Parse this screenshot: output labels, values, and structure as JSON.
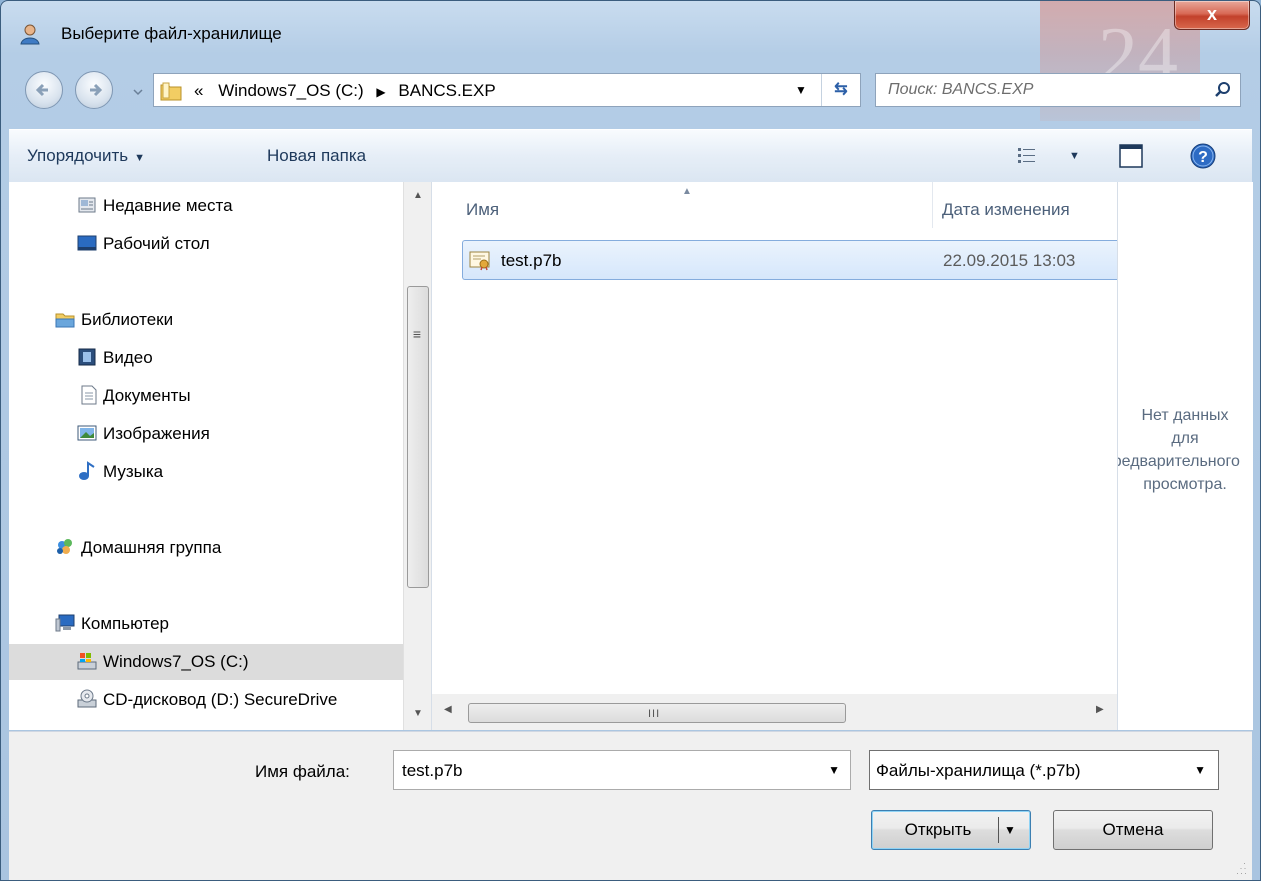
{
  "window": {
    "title": "Выберите файл-хранилище",
    "close_label": "x"
  },
  "navigation": {
    "path_prefix": "«",
    "breadcrumbs": [
      "Windows7_OS (C:)",
      "BANCS.EXP"
    ],
    "search_placeholder": "Поиск: BANCS.EXP"
  },
  "toolbar": {
    "organize_label": "Упорядочить",
    "new_folder_label": "Новая папка"
  },
  "sidebar": {
    "items": [
      {
        "label": "Недавние места",
        "icon": "recent-places-icon"
      },
      {
        "label": "Рабочий стол",
        "icon": "desktop-icon"
      },
      {
        "label": "Библиотеки",
        "icon": "libraries-icon"
      },
      {
        "label": "Видео",
        "icon": "video-icon"
      },
      {
        "label": "Документы",
        "icon": "documents-icon"
      },
      {
        "label": "Изображения",
        "icon": "pictures-icon"
      },
      {
        "label": "Музыка",
        "icon": "music-icon"
      },
      {
        "label": "Домашняя группа",
        "icon": "homegroup-icon"
      },
      {
        "label": "Компьютер",
        "icon": "computer-icon"
      },
      {
        "label": "Windows7_OS (C:)",
        "icon": "hard-drive-icon",
        "selected": true
      },
      {
        "label": "CD-дисковод (D:) SecureDrive",
        "icon": "cd-drive-icon"
      }
    ]
  },
  "file_list": {
    "columns": [
      "Имя",
      "Дата изменения"
    ],
    "rows": [
      {
        "name": "test.p7b",
        "modified": "22.09.2015 13:03",
        "icon": "certificate-file-icon",
        "selected": true
      }
    ],
    "scroll_grip": "III"
  },
  "preview": {
    "lines": [
      "Нет данных",
      "для",
      "предварительного",
      "просмотра."
    ]
  },
  "footer": {
    "filename_label": "Имя файла:",
    "filename_value": "test.p7b",
    "filter_value": "Файлы-хранилища (*.p7b)",
    "open_label": "Открыть",
    "cancel_label": "Отмена"
  },
  "colors": {
    "accent": "#3c7fb1",
    "selection": "#d6e7fb",
    "close": "#c2412b"
  }
}
